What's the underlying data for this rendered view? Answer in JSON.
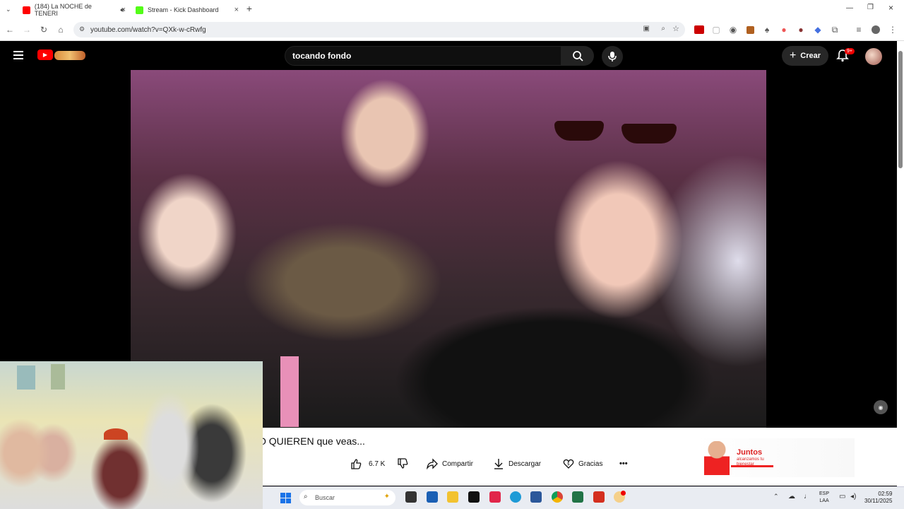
{
  "browser": {
    "tabs": [
      {
        "label": "(184) La NOCHE de TENERI",
        "icon": "youtube-icon",
        "active": true
      },
      {
        "label": "Stream - Kick Dashboard",
        "icon": "kick-icon",
        "active": false
      }
    ],
    "url": "youtube.com/watch?v=QXk-w-cRwfg"
  },
  "youtube": {
    "search_query": "tocando fondo",
    "create_label": "Crear",
    "notifications_badge": "9+"
  },
  "video": {
    "title": "O QUIEREN que veas...",
    "likes": "6.7 K",
    "share_label": "Compartir",
    "download_label": "Descargar",
    "thanks_label": "Gracias",
    "more_label": "•••"
  },
  "ad": {
    "headline": "Juntos",
    "sub": "alcanzamos tu bienestar"
  },
  "taskbar": {
    "search_placeholder": "Buscar",
    "lang_top": "ESP",
    "lang_bottom": "LAA",
    "time": "02:59",
    "date": "30/11/2025"
  },
  "colors": {
    "youtube_red": "#ff0000",
    "kick_green": "#53fc18",
    "dark_bg": "#000000"
  }
}
